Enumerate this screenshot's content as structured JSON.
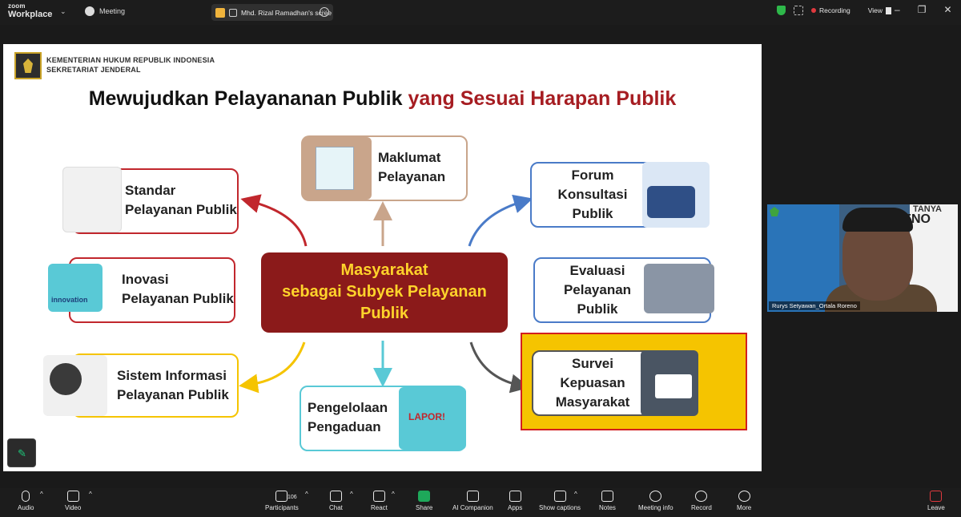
{
  "topbar": {
    "brand_top": "zoom",
    "brand_bottom": "Workplace",
    "meeting_label": "Meeting",
    "share_tab_label": "Mhd. Rizal Ramadhan's scree",
    "recording_label": "Recording",
    "view_label": "View",
    "window_controls": [
      "–",
      "❐",
      "✕"
    ]
  },
  "slide": {
    "ministry_line1": "KEMENTERIAN HUKUM REPUBLIK INDONESIA",
    "ministry_line2": "SEKRETARIAT JENDERAL",
    "title_part1": "Mewujudkan Pelayananan Publik",
    "title_part2": "yang Sesuai Harapan Publik",
    "center_lines": [
      "Masyarakat",
      "sebagai Subyek Pelayanan",
      "Publik"
    ],
    "cards": {
      "standar": [
        "Standar",
        "Pelayanan Publik"
      ],
      "maklumat": [
        "Maklumat",
        "Pelayanan"
      ],
      "forum": [
        "Forum",
        "Konsultasi",
        "Publik"
      ],
      "inovasi": [
        "Inovasi",
        "Pelayanan Publik"
      ],
      "evaluasi": [
        "Evaluasi",
        "Pelayanan",
        "Publik"
      ],
      "sistem": [
        "Sistem Informasi",
        "Pelayanan Publik"
      ],
      "pengelolaan": [
        "Pengelolaan",
        "Pengaduan"
      ],
      "survei": [
        "Survei",
        "Kepuasan",
        "Masyarakat"
      ]
    },
    "lapor_label": "LAPOR!",
    "inovasi_image_text": "innovation",
    "colors": {
      "red": "#c1272d",
      "dark_red": "#8b1a1a",
      "yellow": "#f5c400",
      "tan": "#c9a58b",
      "blue": "#4a7bc8",
      "cyan": "#59c9d6",
      "center_text": "#ffd32b"
    }
  },
  "webcam": {
    "participant_name": "Rurys Setyawan_Ortala Roreno",
    "bg_text_top": "TANYA",
    "bg_text_bottom": "ENO"
  },
  "toolbar": {
    "audio": "Audio",
    "video": "Video",
    "participants": "Participants",
    "participants_count": "106",
    "chat": "Chat",
    "react": "React",
    "share": "Share",
    "ai_companion": "AI Companion",
    "apps": "Apps",
    "show_captions": "Show captions",
    "notes": "Notes",
    "meeting_info": "Meeting info",
    "record": "Record",
    "more": "More",
    "leave": "Leave"
  }
}
